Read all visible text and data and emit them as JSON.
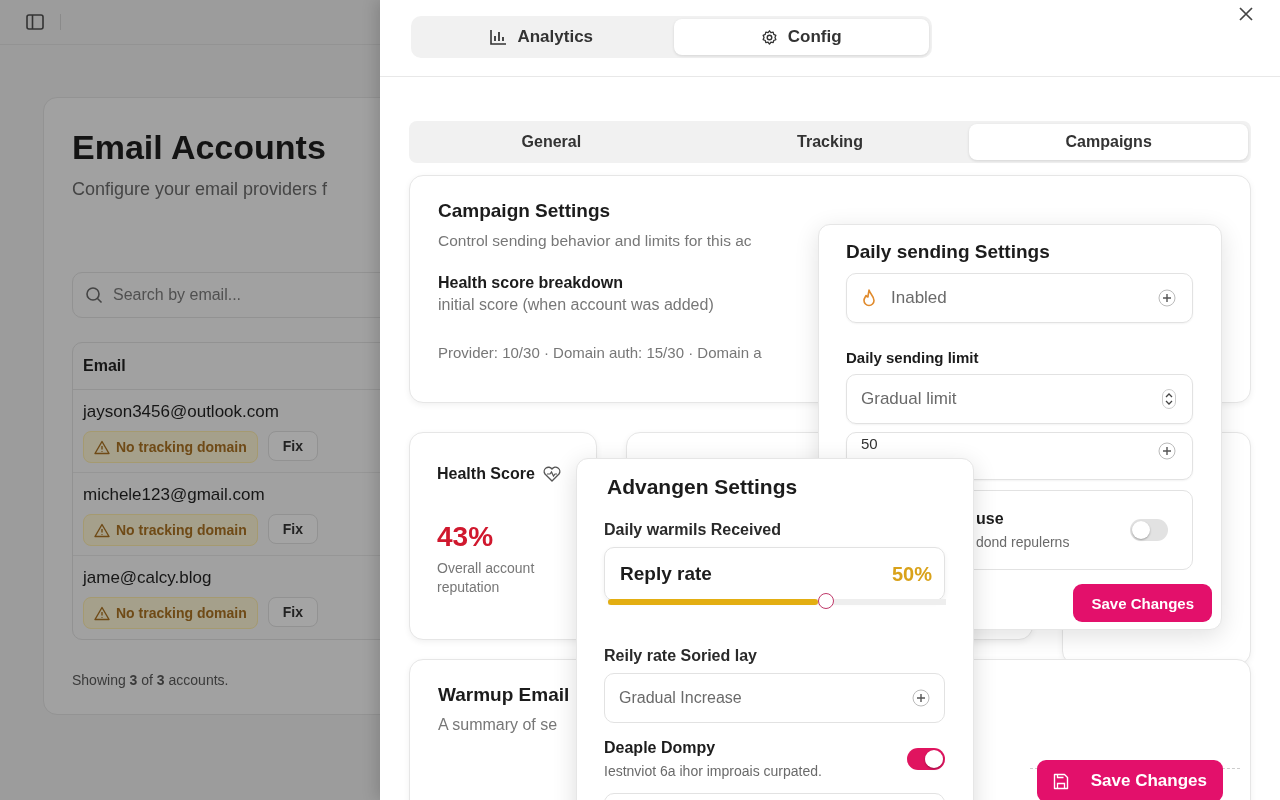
{
  "backdrop": {
    "title": "Email Accounts",
    "subtitle": "Configure your email providers f",
    "search": {
      "placeholder": "Search by email..."
    },
    "table": {
      "columns": [
        "Email"
      ],
      "rows": [
        {
          "email": "jayson3456@outlook.com",
          "warning": "No tracking domain",
          "action": "Fix"
        },
        {
          "email": "michele123@gmail.com",
          "warning": "No tracking domain",
          "action": "Fix"
        },
        {
          "email": "jame@calcy.blog",
          "warning": "No tracking domain",
          "action": "Fix"
        }
      ]
    },
    "footer": "Showing **3** of **3** accounts."
  },
  "sheet": {
    "tabs": [
      {
        "label": "Analytics",
        "selected": false
      },
      {
        "label": "Config",
        "selected": true
      }
    ],
    "sub_tabs": [
      {
        "label": "General",
        "selected": false
      },
      {
        "label": "Tracking",
        "selected": false
      },
      {
        "label": "Campaigns",
        "selected": true
      }
    ],
    "campaign_settings": {
      "title": "Campaign Settings",
      "subtitle": "Control sending behavior and limits for this ac",
      "breakdown_title": "Health score breakdown",
      "breakdown_subtitle": "initial score (when account was added)",
      "breakdown_detail": "Provider: 10/30 · Domain auth: 15/30 · Domain a"
    },
    "health_score": {
      "title": "Health Score",
      "value": "43%",
      "caption": "Overall account reputation"
    },
    "warmup": {
      "title": "Warmup Email",
      "subtitle": "A summary of se"
    },
    "save_button": "Save Changes"
  },
  "daily_popover": {
    "title": "Daily sending Settings",
    "status_field": "Inabled",
    "limit_label": "Daily sending limit",
    "limit_select": "Gradual limit",
    "limit_value": "50",
    "toggle_row": {
      "title": "use",
      "description": "dond repulerns",
      "on": false
    },
    "save_button": "Save Changes"
  },
  "advanced_popover": {
    "title": "Advangen Settings",
    "slider_label": "Daily warmils Received",
    "slider": {
      "label": "Reply rate",
      "reading": "50%",
      "level": 0.62
    },
    "select_label": "Reily rate Soried lay",
    "select_value": "Gradual Increase",
    "toggle_row": {
      "title": "Deaple Dompy",
      "description": "Iestnviot 6a ihor improais curpated.",
      "on": true
    }
  }
}
